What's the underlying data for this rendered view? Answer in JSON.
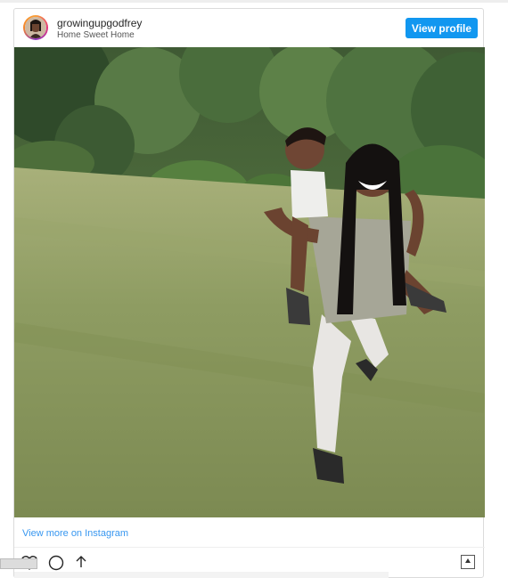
{
  "embed": {
    "username": "growingupgodfrey",
    "subtitle": "Home Sweet Home",
    "view_profile_label": "View profile",
    "view_more_label": "View more on Instagram",
    "photo_alt": "Mother carrying laughing child piggyback on a lawn",
    "icons": [
      "heart-icon",
      "comment-icon",
      "share-icon",
      "bookmark-icon"
    ]
  },
  "colors": {
    "accent": "#1197f0",
    "link": "#3897f0",
    "border": "#dbdbdb"
  }
}
